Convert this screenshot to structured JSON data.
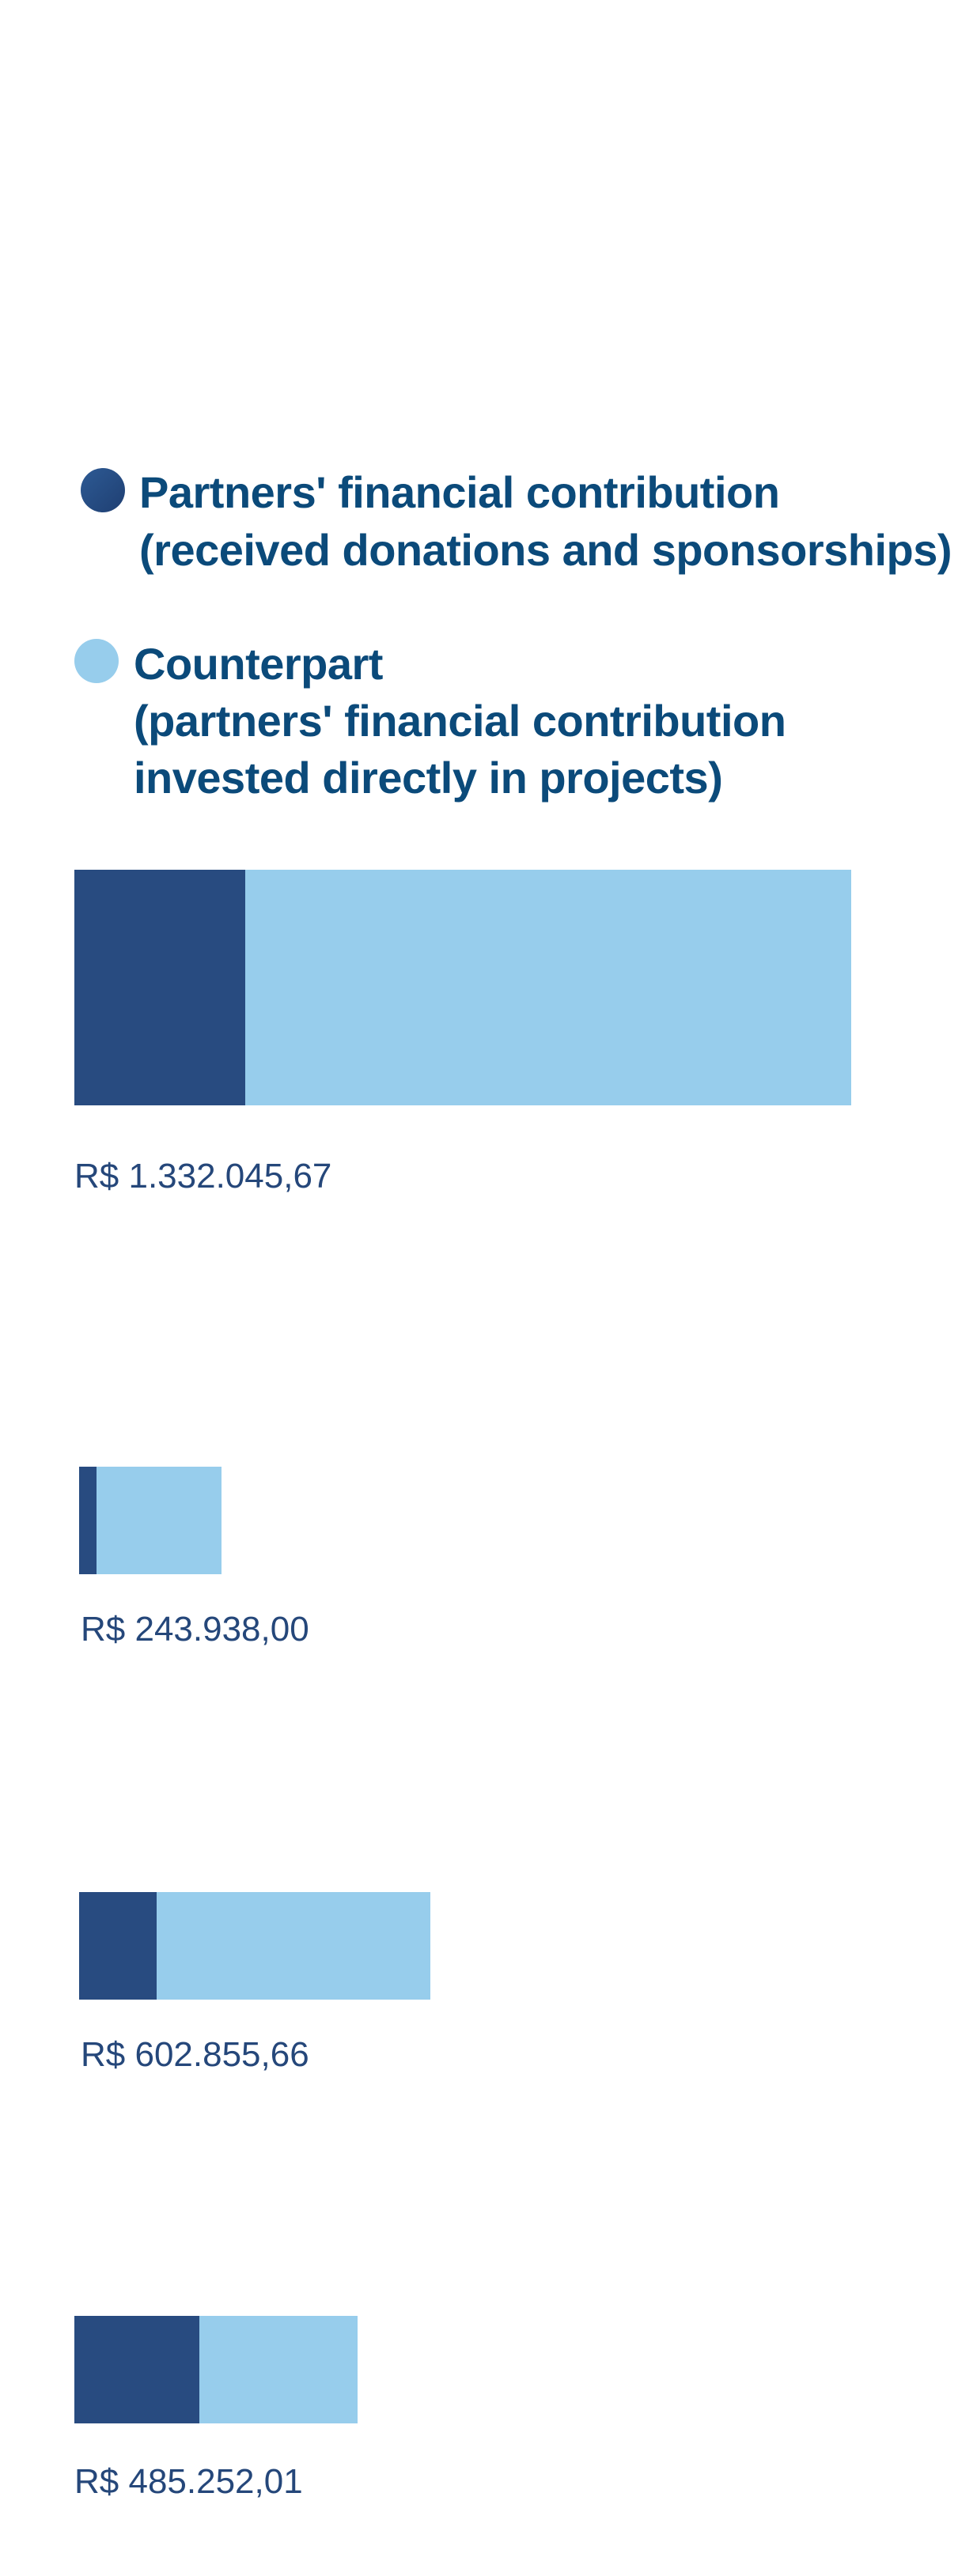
{
  "legend": {
    "series1_line1": "Partners' financial contribution",
    "series1_line2": "(received donations and sponsorships)",
    "series2_line1": "Counterpart",
    "series2_line2": "(partners' financial contribution",
    "series2_line3": "invested directly in projects)"
  },
  "labels": {
    "bar1": "R$ 1.332.045,67",
    "bar2": "R$ 243.938,00",
    "bar3": "R$ 602.855,66",
    "bar4": "R$ 485.252,01"
  },
  "chart_data": {
    "type": "bar",
    "orientation": "horizontal",
    "stacked": true,
    "categories": [
      "",
      "",
      "",
      ""
    ],
    "series": [
      {
        "name": "Partners' financial contribution (received donations and sponsorships)",
        "color": "#284b80"
      },
      {
        "name": "Counterpart (partners' financial contribution invested directly in projects)",
        "color": "#97cdec"
      }
    ],
    "bars": [
      {
        "total": 1332045.67,
        "total_label": "R$ 1.332.045,67",
        "dark_fraction": 0.22
      },
      {
        "total": 243938.0,
        "total_label": "R$ 243.938,00",
        "dark_fraction": 0.12
      },
      {
        "total": 602855.66,
        "total_label": "R$ 602.855,66",
        "dark_fraction": 0.22
      },
      {
        "total": 485252.01,
        "total_label": "R$ 485.252,01",
        "dark_fraction": 0.44
      }
    ],
    "xlabel": "",
    "ylabel": "",
    "grid": false,
    "legend_position": "top"
  }
}
